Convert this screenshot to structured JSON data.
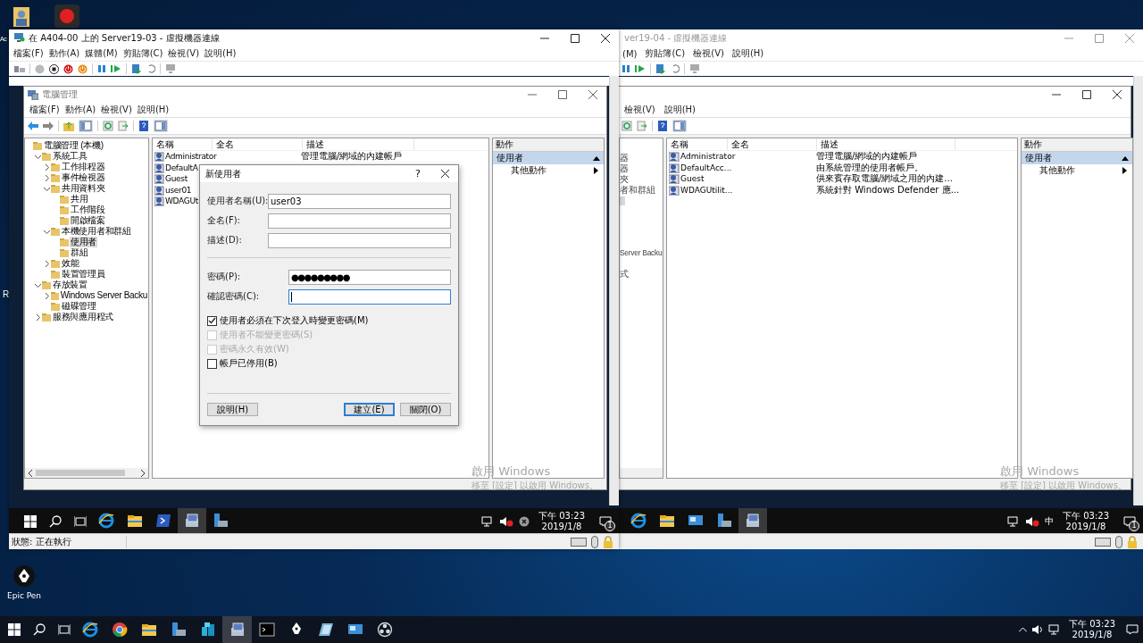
{
  "desktop": {
    "label_fragments": [
      "Ac",
      "R"
    ],
    "shortcut": {
      "label": "Epic Pen"
    }
  },
  "vm_left": {
    "title": "在 A404-00 上的 Server19-03 - 虛擬機器連線",
    "menu": [
      "檔案(F)",
      "動作(A)",
      "媒體(M)",
      "剪貼簿(C)",
      "檢視(V)",
      "說明(H)"
    ],
    "mmc": {
      "title": "電腦管理",
      "menu": [
        "檔案(F)",
        "動作(A)",
        "檢視(V)",
        "說明(H)"
      ],
      "tree": [
        {
          "label": "電腦管理 (本機)",
          "selected": false,
          "children": [
            {
              "label": "系統工具",
              "expanded": true,
              "selected": false,
              "children": [
                {
                  "label": "工作排程器",
                  "expanded": false,
                  "selected": false
                },
                {
                  "label": "事件檢視器",
                  "expanded": false,
                  "selected": false
                },
                {
                  "label": "共用資料夾",
                  "expanded": true,
                  "selected": false,
                  "children": [
                    {
                      "label": "共用",
                      "selected": false
                    },
                    {
                      "label": "工作階段",
                      "selected": false
                    },
                    {
                      "label": "開啟檔案",
                      "selected": false
                    }
                  ]
                },
                {
                  "label": "本機使用者和群組",
                  "expanded": true,
                  "selected": false,
                  "children": [
                    {
                      "label": "使用者",
                      "selected": true
                    },
                    {
                      "label": "群組",
                      "selected": false
                    }
                  ]
                },
                {
                  "label": "效能",
                  "expanded": false,
                  "selected": false
                },
                {
                  "label": "裝置管理員",
                  "selected": false
                }
              ]
            },
            {
              "label": "存放裝置",
              "expanded": true,
              "selected": false,
              "children": [
                {
                  "label": "Windows Server Backu",
                  "expanded": false,
                  "selected": false
                },
                {
                  "label": "磁碟管理",
                  "selected": false
                }
              ]
            },
            {
              "label": "服務與應用程式",
              "expanded": false,
              "selected": false
            }
          ]
        }
      ],
      "columns": [
        "名稱",
        "全名",
        "描述"
      ],
      "rows": [
        {
          "name": "Administrator",
          "description": "管理電腦/網域的內建帳戶"
        },
        {
          "name": "DefaultA"
        },
        {
          "name": "Guest"
        },
        {
          "name": "user01"
        },
        {
          "name": "WDAGUt"
        }
      ],
      "actions": {
        "header": "動作",
        "section": "使用者",
        "item": "其他動作"
      }
    },
    "activation": {
      "title": "啟用 Windows",
      "hint": "移至 [設定] 以啟用 Windows。"
    },
    "taskbar": {
      "apps": [
        {
          "kind": "ie",
          "active": false
        },
        {
          "kind": "explorer",
          "active": false
        },
        {
          "kind": "powershell",
          "active": false
        },
        {
          "kind": "hyperv",
          "active": true
        },
        {
          "kind": "servermanager",
          "active": false
        }
      ],
      "time": "下午 03:23",
      "date": "2019/1/8",
      "notifications": "1"
    },
    "status": "狀態: 正在執行"
  },
  "vm_right": {
    "title": "ver19-04 - 虛擬機器連線",
    "menu": [
      "(M)",
      "剪貼簿(C)",
      "檢視(V)",
      "說明(H)"
    ],
    "mmc": {
      "menu": [
        "檢視(V)",
        "說明(H)"
      ],
      "tree_top": [
        "器",
        "器",
        "夾",
        "者和群組"
      ],
      "tree_bottom": [
        "Server Backu",
        "式"
      ],
      "columns": [
        "名稱",
        "全名",
        "描述"
      ],
      "rows": [
        {
          "name": "Administrator",
          "description": "管理電腦/網域的內建帳戶"
        },
        {
          "name": "DefaultAcc...",
          "description": "由系統管理的使用者帳戶。"
        },
        {
          "name": "Guest",
          "description": "供來賓存取電腦/網域之用的內建..."
        },
        {
          "name": "WDAGUtilit...",
          "description": "系統針對 Windows Defender 應..."
        }
      ],
      "actions": {
        "header": "動作",
        "section": "使用者",
        "item": "其他動作"
      }
    },
    "activation": {
      "title": "啟用 Windows",
      "hint": "移至 [設定] 以啟用 Windows。"
    },
    "taskbar": {
      "apps": [
        {
          "kind": "ie",
          "active": false
        },
        {
          "kind": "explorer",
          "active": false
        },
        {
          "kind": "rdp",
          "active": false
        },
        {
          "kind": "servermanager",
          "active": false
        },
        {
          "kind": "hyperv",
          "active": true
        }
      ],
      "ime": "中",
      "time": "下午 03:23",
      "date": "2019/1/8",
      "notifications": "1"
    }
  },
  "dialog": {
    "title": "新使用者",
    "help": "?",
    "fields": [
      {
        "label": "使用者名稱(U):",
        "value": "user03",
        "focused": false
      },
      {
        "label": "全名(F):",
        "focused": false
      },
      {
        "label": "描述(D):",
        "focused": false
      }
    ],
    "password_fields": [
      {
        "label": "密碼(P):",
        "value": "●●●●●●●●●",
        "focused": false
      },
      {
        "label": "確認密碼(C):",
        "focused": true
      }
    ],
    "options": [
      {
        "label": "使用者必須在下次登入時變更密碼(M)",
        "checked": true,
        "disabled": false
      },
      {
        "label": "使用者不能變更密碼(S)",
        "checked": false,
        "disabled": true
      },
      {
        "label": "密碼永久有效(W)",
        "checked": false,
        "disabled": true
      },
      {
        "label": "帳戶已停用(B)",
        "checked": false,
        "disabled": false
      }
    ],
    "buttons": [
      {
        "label": "說明(H)",
        "default": false
      },
      {
        "label": "建立(E)",
        "default": true
      },
      {
        "label": "關閉(O)",
        "default": false
      }
    ]
  },
  "taskbar": {
    "apps": [
      {
        "kind": "ie",
        "active": false
      },
      {
        "kind": "chrome",
        "active": false
      },
      {
        "kind": "explorer",
        "active": false
      },
      {
        "kind": "servermanager",
        "active": false
      },
      {
        "kind": "cubes",
        "active": false
      },
      {
        "kind": "hyperv",
        "active": true
      },
      {
        "kind": "cmd",
        "active": false
      },
      {
        "kind": "epicpen",
        "active": false
      },
      {
        "kind": "tablet",
        "active": false
      },
      {
        "kind": "rdp",
        "active": false
      },
      {
        "kind": "obs",
        "active": false
      }
    ],
    "time": "下午 03:23",
    "date": "2019/1/8"
  }
}
